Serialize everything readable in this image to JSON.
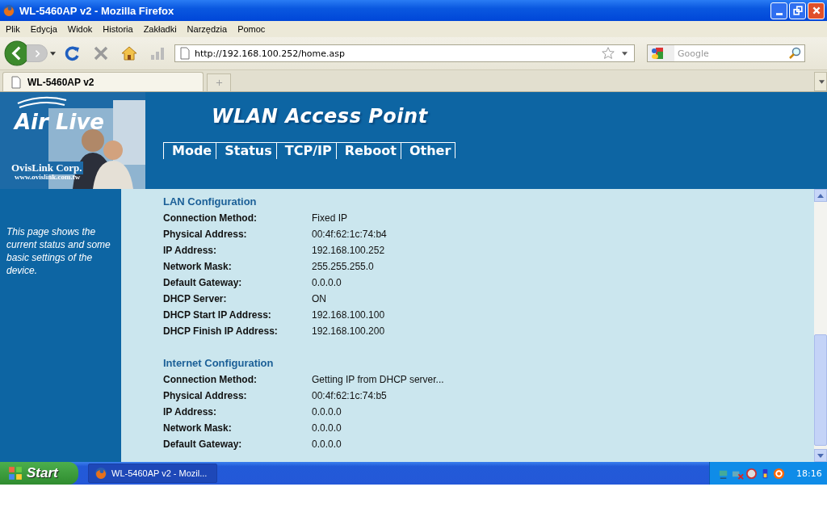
{
  "window": {
    "title": "WL-5460AP v2 - Mozilla Firefox"
  },
  "menu": [
    "Plik",
    "Edycja",
    "Widok",
    "Historia",
    "Zakładki",
    "Narzędzia",
    "Pomoc"
  ],
  "address": {
    "value": "http://192.168.100.252/home.asp"
  },
  "search": {
    "placeholder": "Google"
  },
  "tabs": [
    {
      "label": "WL-5460AP v2",
      "selected": true
    }
  ],
  "logo": {
    "brand": "Air Live",
    "company": "OvisLink Corp.",
    "website": "www.ovislink.com.tw"
  },
  "page_title": "WLAN Access Point",
  "nav": [
    {
      "label": "Mode"
    },
    {
      "label": "Status"
    },
    {
      "label": "TCP/IP"
    },
    {
      "label": "Reboot"
    },
    {
      "label": "Other"
    }
  ],
  "sidebar_text": "This page shows the current status and some basic settings of the device.",
  "sections": [
    {
      "title": "LAN Configuration",
      "rows": [
        {
          "label": "Connection Method:",
          "value": "Fixed IP"
        },
        {
          "label": "Physical Address:",
          "value": "00:4f:62:1c:74:b4"
        },
        {
          "label": "IP Address:",
          "value": "192.168.100.252"
        },
        {
          "label": "Network Mask:",
          "value": "255.255.255.0"
        },
        {
          "label": "Default Gateway:",
          "value": "0.0.0.0"
        },
        {
          "label": "DHCP Server:",
          "value": "ON"
        },
        {
          "label": "DHCP Start IP Address:",
          "value": "192.168.100.100"
        },
        {
          "label": "DHCP Finish IP Address:",
          "value": "192.168.100.200"
        }
      ]
    },
    {
      "title": "Internet Configuration",
      "rows": [
        {
          "label": "Connection Method:",
          "value": "Getting IP from DHCP server..."
        },
        {
          "label": "Physical Address:",
          "value": "00:4f:62:1c:74:b5"
        },
        {
          "label": "IP Address:",
          "value": "0.0.0.0"
        },
        {
          "label": "Network Mask:",
          "value": "0.0.0.0"
        },
        {
          "label": "Default Gateway:",
          "value": "0.0.0.0"
        }
      ]
    }
  ],
  "taskbar": {
    "start": "Start",
    "tasks": [
      {
        "label": "WL-5460AP v2 - Mozil...",
        "selected": true
      }
    ],
    "clock": "18:16"
  }
}
